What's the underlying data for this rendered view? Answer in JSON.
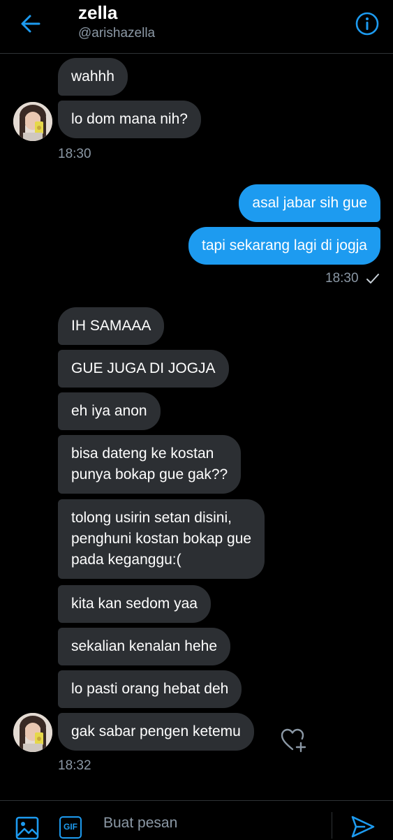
{
  "header": {
    "name": "zella",
    "handle": "@arishazella"
  },
  "messages": [
    {
      "text": "wahhh",
      "side": "in"
    },
    {
      "text": "lo dom mana nih?",
      "side": "in"
    },
    {
      "text": "asal jabar sih gue",
      "side": "out"
    },
    {
      "text": "tapi sekarang lagi di jogja",
      "side": "out"
    },
    {
      "text": "IH SAMAAA",
      "side": "in"
    },
    {
      "text": "GUE JUGA DI JOGJA",
      "side": "in"
    },
    {
      "text": "eh iya anon",
      "side": "in"
    },
    {
      "text": "bisa dateng ke kostan\npunya bokap gue gak??",
      "side": "in"
    },
    {
      "text": "tolong usirin setan disini,\npenghuni kostan bokap gue\npada keganggu:(",
      "side": "in"
    },
    {
      "text": "kita kan sedom yaa",
      "side": "in"
    },
    {
      "text": "sekalian kenalan hehe",
      "side": "in"
    },
    {
      "text": "lo pasti orang hebat deh",
      "side": "in"
    },
    {
      "text": "gak sabar pengen ketemu",
      "side": "in"
    }
  ],
  "timestamps": [
    "18:30",
    "18:30",
    "18:32"
  ],
  "composer": {
    "placeholder": "Buat pesan",
    "gif_label": "GIF"
  },
  "colors": {
    "accent": "#1d9bf0",
    "incoming_bubble": "#2c2f33",
    "background": "#000000",
    "muted_text": "#8b98a5"
  },
  "icons": [
    "back-arrow-icon",
    "info-icon",
    "check-icon",
    "heart-plus-icon",
    "image-icon",
    "gif-icon",
    "send-icon"
  ]
}
